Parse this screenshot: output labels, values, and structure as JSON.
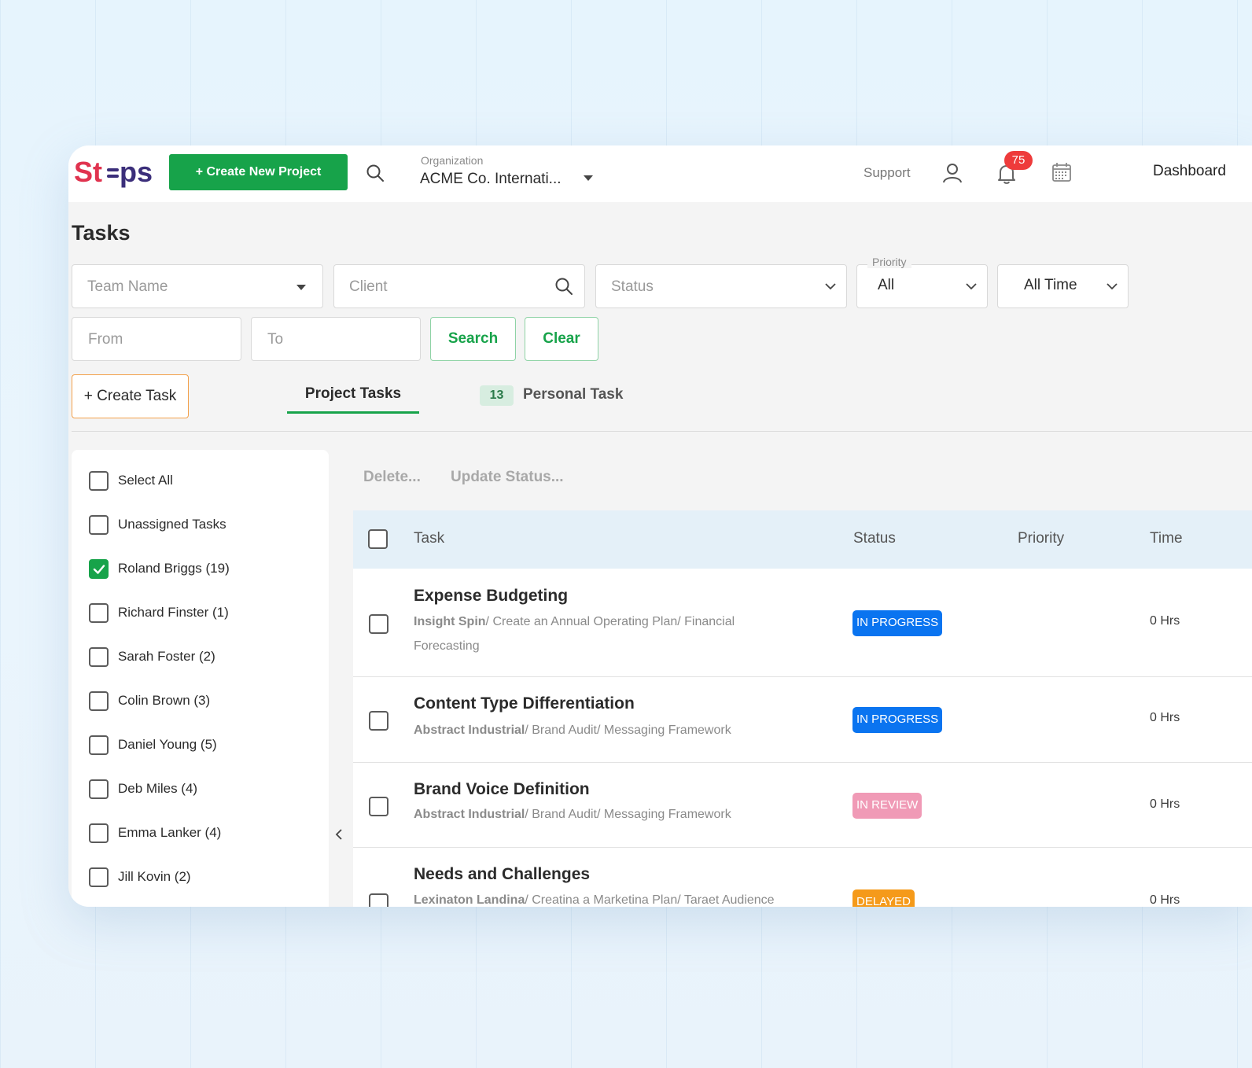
{
  "header": {
    "logo_text": "Steps",
    "create_project_label": "+ Create New Project",
    "org_label": "Organization",
    "org_value": "ACME Co. Internati...",
    "support_label": "Support",
    "notification_count": "75",
    "dashboard_label": "Dashboard"
  },
  "page": {
    "title": "Tasks"
  },
  "filters": {
    "team_name_placeholder": "Team Name",
    "client_placeholder": "Client",
    "status_placeholder": "Status",
    "priority_legend": "Priority",
    "priority_value": "All",
    "time_value": "All Time",
    "from_placeholder": "From",
    "to_placeholder": "To",
    "search_label": "Search",
    "clear_label": "Clear"
  },
  "actions": {
    "create_task_label": "+ Create Task"
  },
  "tabs": {
    "project_tasks": "Project Tasks",
    "personal_count": "13",
    "personal_task": "Personal Task"
  },
  "assignees": [
    {
      "label": "Select All",
      "checked": false
    },
    {
      "label": "Unassigned Tasks",
      "checked": false
    },
    {
      "label": "Roland Briggs (19)",
      "checked": true
    },
    {
      "label": "Richard Finster (1)",
      "checked": false
    },
    {
      "label": "Sarah Foster (2)",
      "checked": false
    },
    {
      "label": "Colin Brown (3)",
      "checked": false
    },
    {
      "label": "Daniel Young (5)",
      "checked": false
    },
    {
      "label": "Deb Miles (4)",
      "checked": false
    },
    {
      "label": "Emma Lanker (4)",
      "checked": false
    },
    {
      "label": "Jill Kovin (2)",
      "checked": false
    }
  ],
  "bulk": {
    "delete_label": "Delete...",
    "update_status_label": "Update Status..."
  },
  "table": {
    "headers": {
      "task": "Task",
      "status": "Status",
      "priority": "Priority",
      "time": "Time"
    },
    "rows": [
      {
        "title": "Expense Budgeting",
        "client": "Insight Spin",
        "path": "/ Create an Annual Operating Plan/ Financial Forecasting",
        "status": "IN PROGRESS",
        "status_color": "#0a74f0",
        "time": "0 Hrs"
      },
      {
        "title": "Content Type Differentiation",
        "client": "Abstract Industrial",
        "path": "/ Brand Audit/ Messaging Framework",
        "status": "IN PROGRESS",
        "status_color": "#0a74f0",
        "time": "0 Hrs"
      },
      {
        "title": "Brand Voice Definition",
        "client": "Abstract Industrial",
        "path": "/ Brand Audit/ Messaging Framework",
        "status": "IN REVIEW",
        "status_color": "#f09ab6",
        "time": "0 Hrs"
      },
      {
        "title": "Needs and Challenges",
        "client": "Lexinaton Landina",
        "path": "/ Creatina a Marketina Plan/ Taraet Audience",
        "status": "DELAYED",
        "status_color": "#f59a1a",
        "time": "0 Hrs"
      }
    ]
  },
  "colors": {
    "accent": "#17a34a",
    "create_task_border": "#f3a04a",
    "badge": "#ee3b3b"
  }
}
